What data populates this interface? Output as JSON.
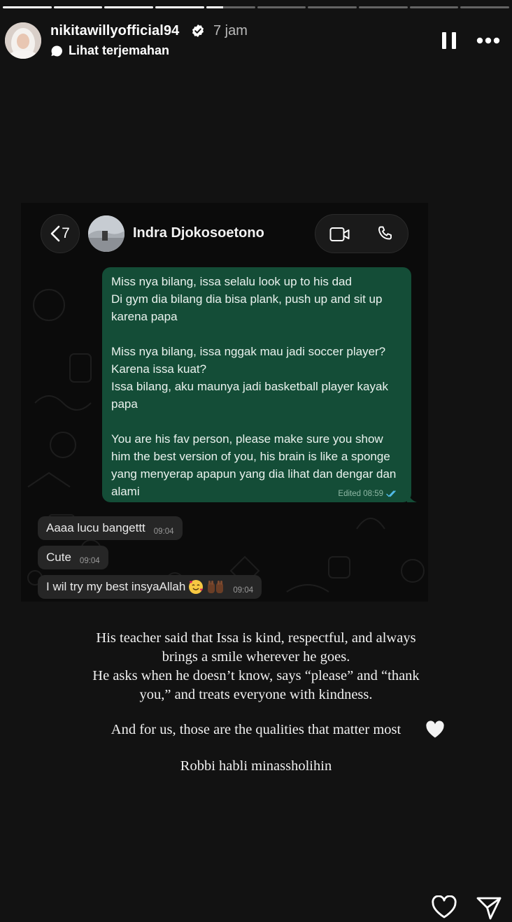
{
  "story": {
    "segments": [
      1,
      1,
      1,
      1,
      0.35,
      0,
      0,
      0,
      0,
      0
    ]
  },
  "header": {
    "username": "nikitawillyofficial94",
    "time": "7 jam",
    "translate_label": "Lihat terjemahan"
  },
  "chat": {
    "back_count": "7",
    "contact_name": "Indra Djokosoetono",
    "outgoing": {
      "text": "Miss nya bilang, issa selalu look up to his dad\nDi gym dia bilang dia bisa plank, push up and sit up karena papa\n\nMiss nya bilang, issa nggak mau jadi soccer player? Karena issa kuat?\nIssa bilang, aku maunya jadi basketball player kayak papa\n\nYou are his fav person, please make sure you show him the best version of you, his brain is like a sponge yang menyerap apapun yang dia lihat dan dengar dan alami",
      "meta": "Edited 08:59"
    },
    "incoming": [
      {
        "text": "Aaaa lucu bangettt",
        "time": "09:04"
      },
      {
        "text": "Cute",
        "time": "09:04"
      },
      {
        "text": "I wil try my best insyaAllah",
        "time": "09:04"
      }
    ]
  },
  "caption": {
    "line1": "His teacher said that Issa is kind, respectful, and always",
    "line2": "brings a smile wherever he goes.",
    "line3": "He asks when he doesn’t know, says “please” and “thank",
    "line4": "you,” and treats everyone with kindness.",
    "line5": "And for us, those are the qualities that matter most",
    "line6": "Robbi habli minassholihin"
  },
  "icons": {
    "verified": "verified-badge-icon",
    "pause": "pause-icon",
    "more": "more-options-icon",
    "video": "video-call-icon",
    "phone": "phone-icon",
    "like": "heart-outline-icon",
    "send": "send-paper-plane-icon"
  },
  "colors": {
    "background": "#121212",
    "outgoing_bubble": "#144d37",
    "incoming_bubble": "#262626",
    "read_ticks": "#53bdeb"
  }
}
